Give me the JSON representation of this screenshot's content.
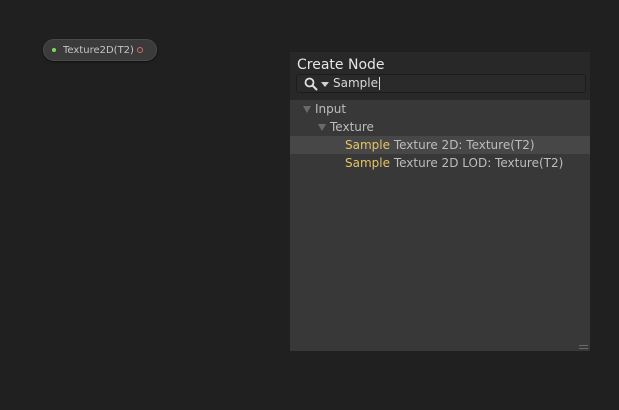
{
  "canvas": {
    "node": {
      "label": "Texture2D(T2)"
    }
  },
  "create_node": {
    "title": "Create Node",
    "search": {
      "value": "Sample",
      "icon": "search-icon"
    },
    "tree": [
      {
        "label": "Input",
        "level": 0,
        "expanded": true
      },
      {
        "label": "Texture",
        "level": 1,
        "expanded": true
      },
      {
        "match": "Sample",
        "rest": " Texture 2D: Texture(T2)",
        "level": 2,
        "selected": true
      },
      {
        "match": "Sample",
        "rest": " Texture 2D LOD: Texture(T2)",
        "level": 2,
        "selected": false
      }
    ]
  },
  "colors": {
    "background": "#202020",
    "panel": "#383838",
    "highlight": "#e6c466",
    "input_port": "#7ed957",
    "output_port": "#d66a6a"
  }
}
